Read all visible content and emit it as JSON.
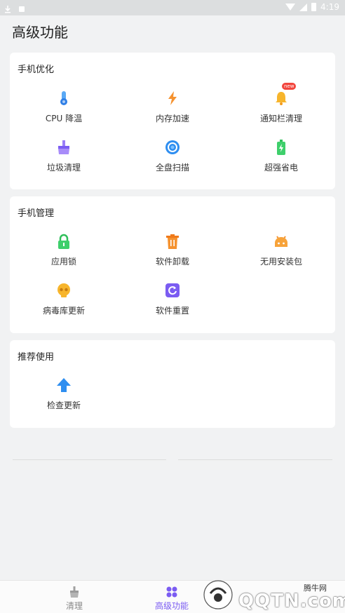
{
  "page": {
    "title": "高级功能"
  },
  "sections": [
    {
      "title": "手机优化",
      "items": [
        {
          "label": "CPU 降温",
          "icon": "thermometer-icon"
        },
        {
          "label": "内存加速",
          "icon": "lightning-icon"
        },
        {
          "label": "通知栏清理",
          "icon": "bell-icon",
          "badge": "new"
        },
        {
          "label": "垃圾清理",
          "icon": "broom-icon"
        },
        {
          "label": "全盘扫描",
          "icon": "scan-icon"
        },
        {
          "label": "超强省电",
          "icon": "battery-icon"
        }
      ]
    },
    {
      "title": "手机管理",
      "items": [
        {
          "label": "应用锁",
          "icon": "lock-icon"
        },
        {
          "label": "软件卸载",
          "icon": "trash-icon"
        },
        {
          "label": "无用安装包",
          "icon": "android-icon"
        },
        {
          "label": "病毒库更新",
          "icon": "skull-icon"
        },
        {
          "label": "软件重置",
          "icon": "reset-icon"
        }
      ]
    },
    {
      "title": "推荐使用",
      "items": [
        {
          "label": "检查更新",
          "icon": "upload-arrow-icon"
        }
      ]
    }
  ],
  "bottom_nav": {
    "tabs": [
      {
        "label": "清理",
        "icon": "broom-icon",
        "active": false
      },
      {
        "label": "高级功能",
        "icon": "grid-icon",
        "active": true
      }
    ]
  },
  "status_bar": {
    "time": "4:19"
  },
  "watermark": {
    "small_text": "腾牛网",
    "logo_text": "QQTN.com"
  },
  "colors": {
    "accent": "#7b5cf2",
    "background": "#f1f2f3",
    "card": "#ffffff"
  }
}
